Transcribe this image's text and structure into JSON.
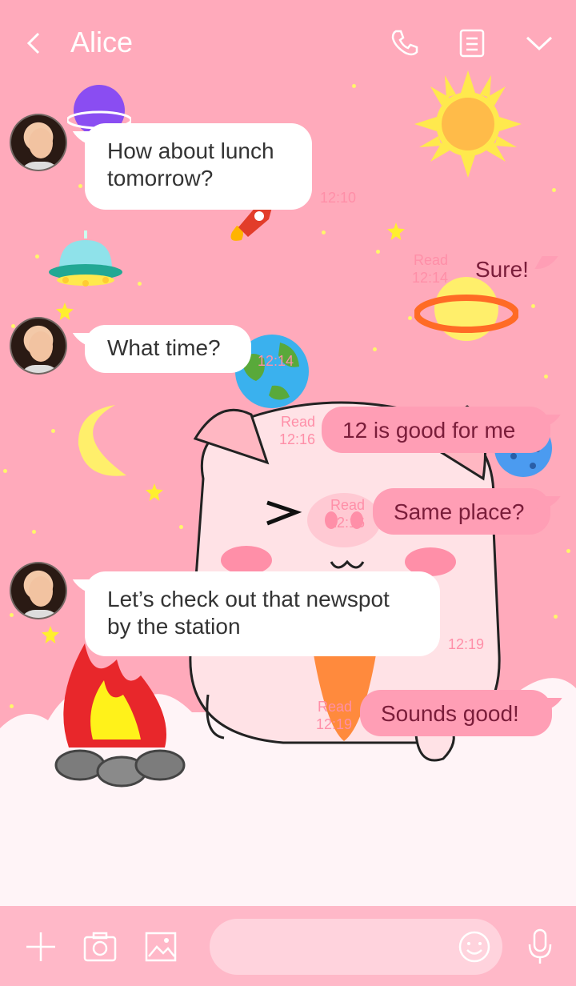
{
  "header": {
    "back_icon": "chevron-left-icon",
    "title": "Alice",
    "call_icon": "phone-icon",
    "notes_icon": "notes-icon",
    "menu_icon": "chevron-down-icon"
  },
  "messages": [
    {
      "side": "in",
      "text_lines": [
        "How about lunch",
        "tomorrow?"
      ],
      "time": "12:10"
    },
    {
      "side": "out",
      "text": "Sure!",
      "read": "Read",
      "time": "12:14"
    },
    {
      "side": "in",
      "text": "What time?",
      "time": "12:14"
    },
    {
      "side": "out",
      "text": "12 is good for me",
      "read": "Read",
      "time": "12:16"
    },
    {
      "side": "out",
      "text": "Same place?",
      "read": "Read",
      "time": "12:16"
    },
    {
      "side": "in",
      "text_lines": [
        "Let’s check out that newspot",
        "by the station"
      ],
      "time": "12:19"
    },
    {
      "side": "out",
      "text": "Sounds good!",
      "read": "Read",
      "time": "12:19"
    }
  ],
  "bottom_bar": {
    "add_icon": "plus-icon",
    "camera_icon": "camera-icon",
    "image_icon": "image-icon",
    "input_value": "",
    "emoji_icon": "smiley-icon",
    "mic_icon": "microphone-icon"
  },
  "colors": {
    "background": "#ffaabb",
    "outgoing_bubble": "#ff9eb5",
    "incoming_bubble": "#ffffff",
    "header_text": "#ffffff"
  }
}
